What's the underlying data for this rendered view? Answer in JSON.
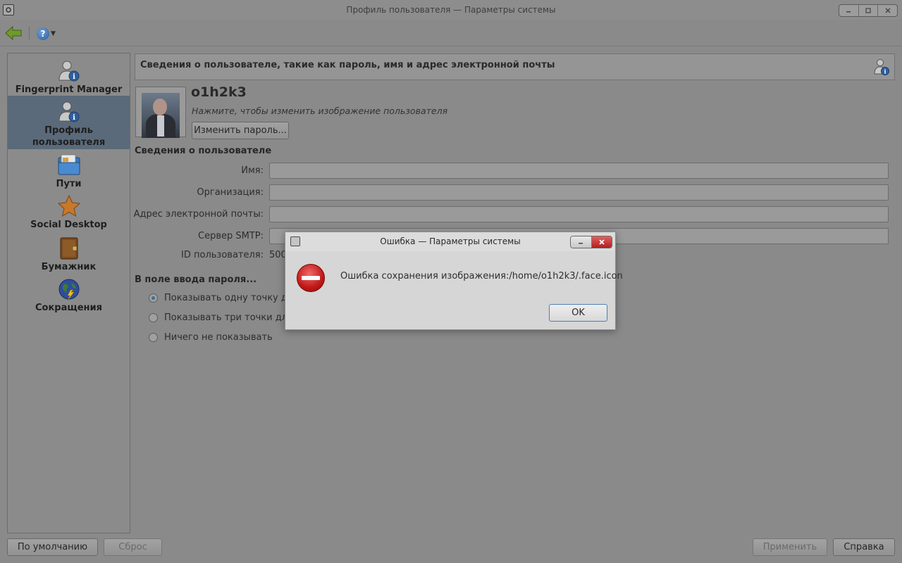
{
  "window": {
    "title": "Профиль пользователя — Параметры системы"
  },
  "sidebar": {
    "items": [
      {
        "label": "Fingerprint Manager",
        "icon": "user-info-icon",
        "selected": false
      },
      {
        "label": "Профиль пользователя",
        "icon": "user-info-icon",
        "selected": true
      },
      {
        "label": "Пути",
        "icon": "folder-icon",
        "selected": false
      },
      {
        "label": "Social Desktop",
        "icon": "star-icon",
        "selected": false
      },
      {
        "label": "Бумажник",
        "icon": "wallet-icon",
        "selected": false
      },
      {
        "label": "Сокращения",
        "icon": "globe-icon",
        "selected": false
      }
    ]
  },
  "header": {
    "text": "Сведения о пользователе, такие как пароль, имя и адрес электронной почты"
  },
  "profile": {
    "username": "o1h2k3",
    "change_image_hint": "Нажмите, чтобы изменить изображение пользователя",
    "change_password_button": "Изменить пароль..."
  },
  "user_info": {
    "section_title": "Сведения о пользователе",
    "name_label": "Имя:",
    "name_value": "",
    "org_label": "Организация:",
    "org_value": "",
    "email_label": "Адрес электронной почты:",
    "email_value": "",
    "smtp_label": "Сервер SMTP:",
    "smtp_value": "",
    "id_label": "ID пользователя:",
    "id_value": "500"
  },
  "password_echo": {
    "section_title": "В поле ввода пароля...",
    "options": [
      {
        "label": "Показывать одну точку для",
        "checked": true
      },
      {
        "label": "Показывать три точки для к",
        "checked": false
      },
      {
        "label": "Ничего не показывать",
        "checked": false
      }
    ]
  },
  "bottom": {
    "defaults_button": "По умолчанию",
    "reset_button": "Сброс",
    "apply_button": "Применить",
    "help_button": "Справка"
  },
  "dialog": {
    "title": "Ошибка — Параметры системы",
    "message": "Ошибка сохранения изображения:/home/o1h2k3/.face.icon",
    "ok_button": "OK"
  },
  "colors": {
    "selected_bg": "#5a6a7a",
    "error_red": "#c01818",
    "focus_blue": "#4f7fb0"
  }
}
